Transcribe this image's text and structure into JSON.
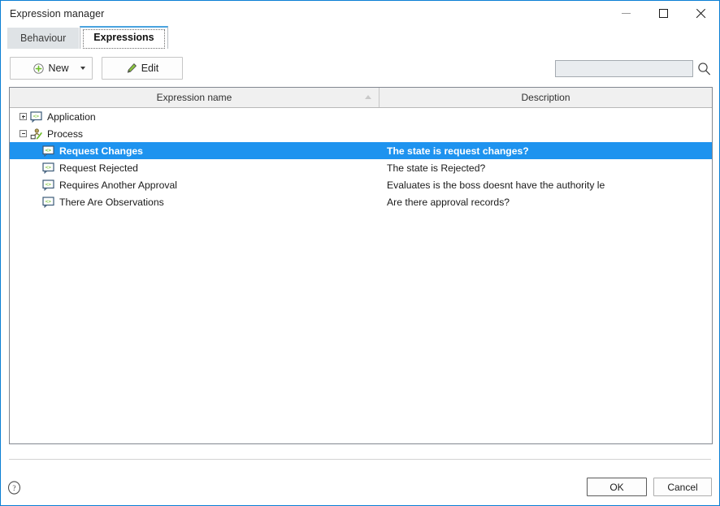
{
  "window": {
    "title": "Expression manager",
    "controls": {
      "minimize": "minimize-icon",
      "maximize": "maximize-icon",
      "close": "close-icon"
    },
    "border_color": "#0a7fd4"
  },
  "tabs": [
    {
      "label": "Behaviour",
      "active": false
    },
    {
      "label": "Expressions",
      "active": true
    }
  ],
  "toolbar": {
    "new_label": "New",
    "new_icon": "plus-circle-icon",
    "new_dropdown_icon": "chevron-down-icon",
    "edit_label": "Edit",
    "edit_icon": "pencil-icon"
  },
  "search": {
    "value": "",
    "placeholder": "",
    "icon": "search-icon"
  },
  "list": {
    "columns": [
      {
        "label": "Expression name",
        "sort": "ascending"
      },
      {
        "label": "Description",
        "sort": "none"
      }
    ],
    "rows": [
      {
        "name": "Application",
        "description": "",
        "level": 0,
        "expander": "collapsed",
        "icon": "expression-group-icon",
        "selected": false
      },
      {
        "name": "Process",
        "description": "",
        "level": 0,
        "expander": "expanded",
        "icon": "process-check-icon",
        "selected": false
      },
      {
        "name": "Request Changes",
        "description": "The state is request changes?",
        "level": 1,
        "expander": "none",
        "icon": "expression-icon",
        "selected": true
      },
      {
        "name": "Request Rejected",
        "description": "The state is Rejected?",
        "level": 1,
        "expander": "none",
        "icon": "expression-icon",
        "selected": false
      },
      {
        "name": "Requires Another Approval",
        "description": "Evaluates is the boss doesnt have the authority le",
        "level": 1,
        "expander": "none",
        "icon": "expression-icon",
        "selected": false
      },
      {
        "name": "There Are Observations",
        "description": "Are there approval records?",
        "level": 1,
        "expander": "none",
        "icon": "expression-icon",
        "selected": false
      }
    ]
  },
  "footer": {
    "help_icon": "help-icon",
    "ok_label": "OK",
    "cancel_label": "Cancel"
  },
  "colors": {
    "selection": "#1e93ef",
    "accent": "#0a7fd4",
    "icon_green": "#8cc63f"
  }
}
